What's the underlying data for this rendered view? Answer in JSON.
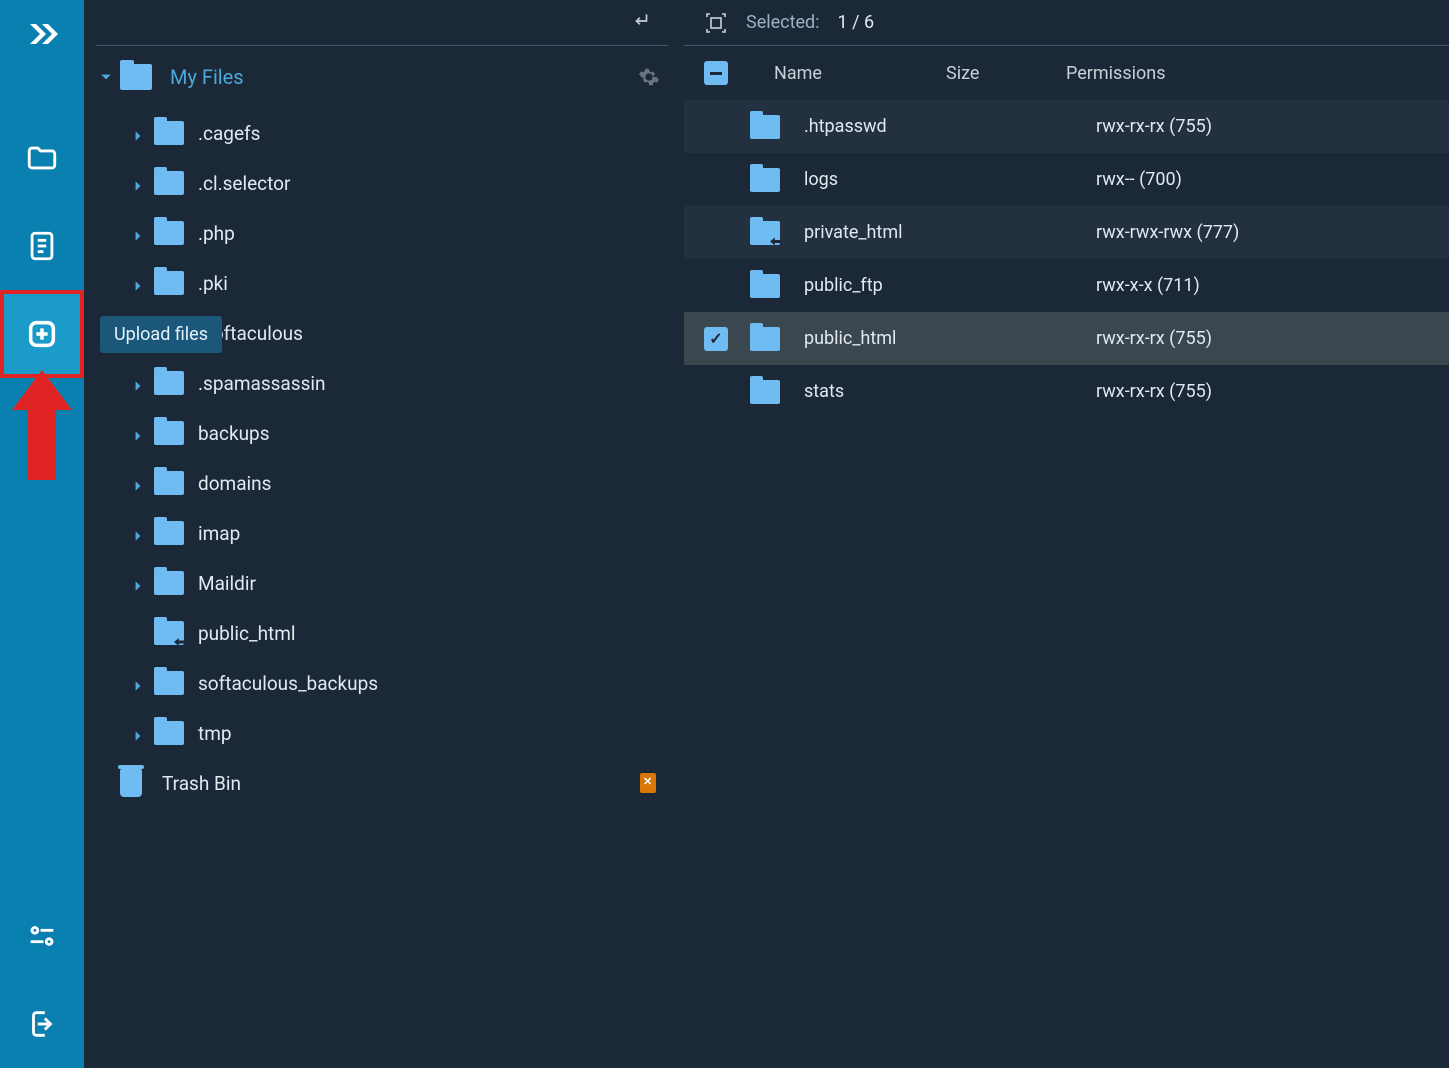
{
  "tooltip": "Upload files",
  "tree": {
    "root_label": "My Files",
    "items": [
      {
        "label": ".cagefs",
        "expandable": true
      },
      {
        "label": ".cl.selector",
        "expandable": true
      },
      {
        "label": ".php",
        "expandable": true
      },
      {
        "label": ".pki",
        "expandable": true
      },
      {
        "label": ".softaculous",
        "expandable": true
      },
      {
        "label": ".spamassassin",
        "expandable": true
      },
      {
        "label": "backups",
        "expandable": true
      },
      {
        "label": "domains",
        "expandable": true
      },
      {
        "label": "imap",
        "expandable": true
      },
      {
        "label": "Maildir",
        "expandable": true
      },
      {
        "label": "public_html",
        "expandable": false,
        "link": true
      },
      {
        "label": "softaculous_backups",
        "expandable": true
      },
      {
        "label": "tmp",
        "expandable": true
      }
    ],
    "trash_label": "Trash Bin"
  },
  "selection": {
    "label": "Selected:",
    "count": "1 / 6"
  },
  "columns": {
    "name": "Name",
    "size": "Size",
    "perm": "Permissions"
  },
  "rows": [
    {
      "name": ".htpasswd",
      "size": "",
      "perm": "rwx-rx-rx (755)",
      "selected": false,
      "link": false
    },
    {
      "name": "logs",
      "size": "",
      "perm": "rwx-- (700)",
      "selected": false,
      "link": false
    },
    {
      "name": "private_html",
      "size": "",
      "perm": "rwx-rwx-rwx (777)",
      "selected": false,
      "link": true
    },
    {
      "name": "public_ftp",
      "size": "",
      "perm": "rwx-x-x (711)",
      "selected": false,
      "link": false
    },
    {
      "name": "public_html",
      "size": "",
      "perm": "rwx-rx-rx (755)",
      "selected": true,
      "link": false
    },
    {
      "name": "stats",
      "size": "",
      "perm": "rwx-rx-rx (755)",
      "selected": false,
      "link": false
    }
  ]
}
